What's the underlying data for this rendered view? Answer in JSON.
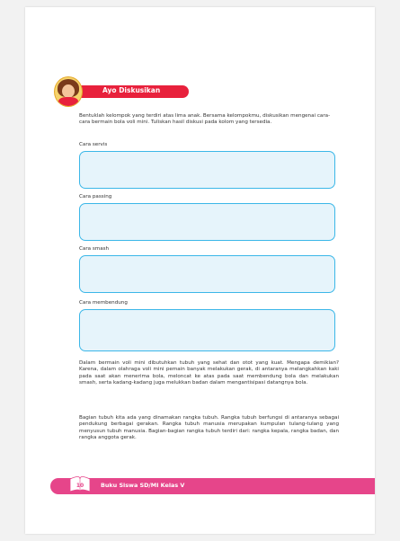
{
  "activity": {
    "title": "Ayo Diskusikan"
  },
  "intro": "Bentuklah kelompok yang terdiri atas lima anak. Bersama kelompokmu, diskusikan mengenai cara-cara bermain bola voli mini. Tuliskan hasil diskusi pada kolom yang tersedia.",
  "sections": [
    {
      "label": "Cara servis"
    },
    {
      "label": "Cara passing"
    },
    {
      "label": "Cara smash"
    },
    {
      "label": "Cara membendung"
    }
  ],
  "paragraphs": [
    "Dalam bermain voli mini dibutuhkan tubuh yang sehat dan otot yang kuat. Mengapa demikian? Karena, dalam olahraga voli mini pemain banyak melakukan gerak, di antaranya melangkahkan kaki pada saat akan menerima bola, meloncat ke atas pada saat membendung bola dan melakukan smash, serta kadang-kadang juga melukkan badan dalam mengantisipasi datangnya bola.",
    "Bagian tubuh kita ada yang dinamakan rangka tubuh. Rangka tubuh berfungsi di antaranya sebagai pendukung berbagai gerakan. Rangka tubuh manusia merupakan kumpulan tulang-tulang yang menyusun tubuh manusia. Bagian-bagian rangka tubuh terdiri dari: rangka kepala, rangka badan, dan rangka anggota gerak."
  ],
  "footer": {
    "page": "10",
    "title": "Buku Siswa SD/MI Kelas V"
  },
  "colors": {
    "accent_red": "#e8213c",
    "box_border": "#3bb7e8",
    "box_fill": "#e6f4fb",
    "footer_pink": "#e6458a"
  }
}
